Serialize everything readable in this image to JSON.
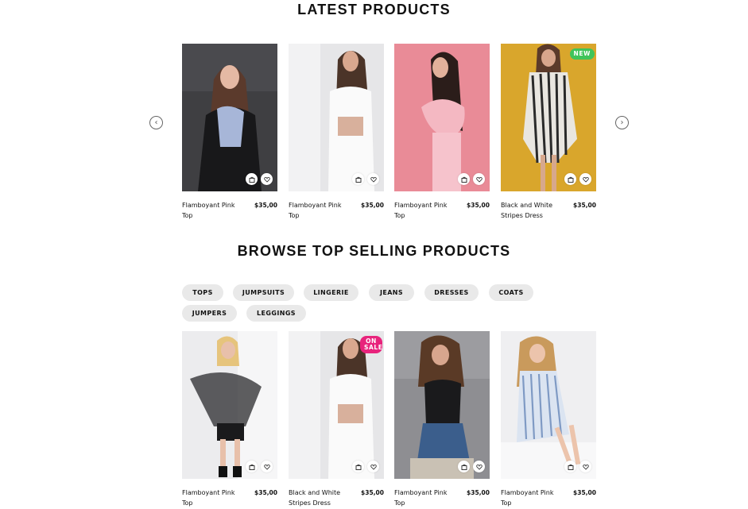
{
  "latest": {
    "title": "LATEST PRODUCTS",
    "products": [
      {
        "name": "Flamboyant Pink Top",
        "price": "$35,00",
        "badge": ""
      },
      {
        "name": "Flamboyant Pink Top",
        "price": "$35,00",
        "badge": ""
      },
      {
        "name": "Flamboyant Pink Top",
        "price": "$35,00",
        "badge": ""
      },
      {
        "name": "Black and White Stripes Dress",
        "price": "$35,00",
        "badge": "NEW"
      }
    ]
  },
  "top_selling": {
    "title": "BROWSE TOP SELLING PRODUCTS",
    "categories": [
      "TOPS",
      "JUMPSUITS",
      "LINGERIE",
      "JEANS",
      "DRESSES",
      "COATS",
      "JUMPERS",
      "LEGGINGS"
    ],
    "products": [
      {
        "name": "Flamboyant Pink Top",
        "price": "$35,00",
        "badge": ""
      },
      {
        "name": "Black and White Stripes Dress",
        "price": "$35,00",
        "badge": "ON SALE"
      },
      {
        "name": "Flamboyant Pink Top",
        "price": "$35,00",
        "badge": ""
      },
      {
        "name": "Flamboyant Pink Top",
        "price": "$35,00",
        "badge": ""
      }
    ]
  },
  "icons": {
    "carousel_prev": "chevron-left-icon",
    "carousel_next": "chevron-right-icon",
    "add_to_cart": "shopping-bag-icon",
    "wishlist": "heart-icon"
  },
  "colors": {
    "badge_new": "#3fc45a",
    "badge_sale": "#e8237c",
    "chip_bg": "#e9e9e9"
  }
}
